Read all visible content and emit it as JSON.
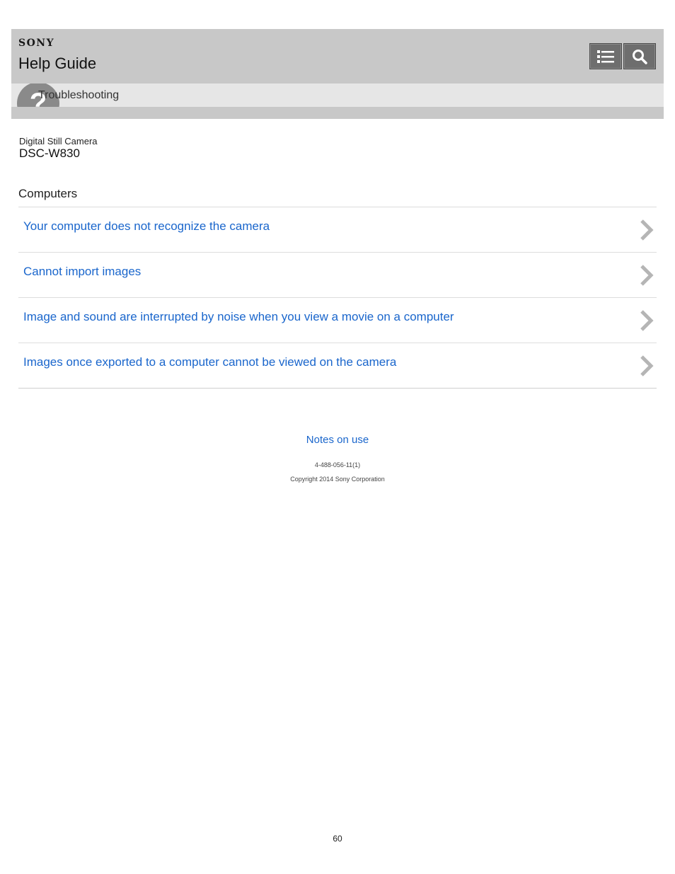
{
  "header": {
    "brand": "SONY",
    "title": "Help Guide",
    "menu_icon": "list-menu-icon",
    "search_icon": "search-icon",
    "button_color": "#6e6e6e",
    "bar_color": "#c8c8c8"
  },
  "breadcrumb": {
    "icon": "question-mark-icon",
    "icon_glyph": "?",
    "label": "Troubleshooting"
  },
  "product": {
    "type": "Digital Still Camera",
    "model": "DSC-W830"
  },
  "section_title": "Computers",
  "items": [
    {
      "label": "Your computer does not recognize the camera"
    },
    {
      "label": "Cannot import images"
    },
    {
      "label": "Image and sound are interrupted by noise when you view a movie on a computer"
    },
    {
      "label": "Images once exported to a computer cannot be viewed on the camera"
    }
  ],
  "footer": {
    "notes_link": "Notes on use",
    "code": "4-488-056-11(1)",
    "copyright": "Copyright 2014 Sony Corporation",
    "page_number": "60"
  },
  "colors": {
    "link": "#1a66cc",
    "chevron": "#b5b5b5"
  }
}
